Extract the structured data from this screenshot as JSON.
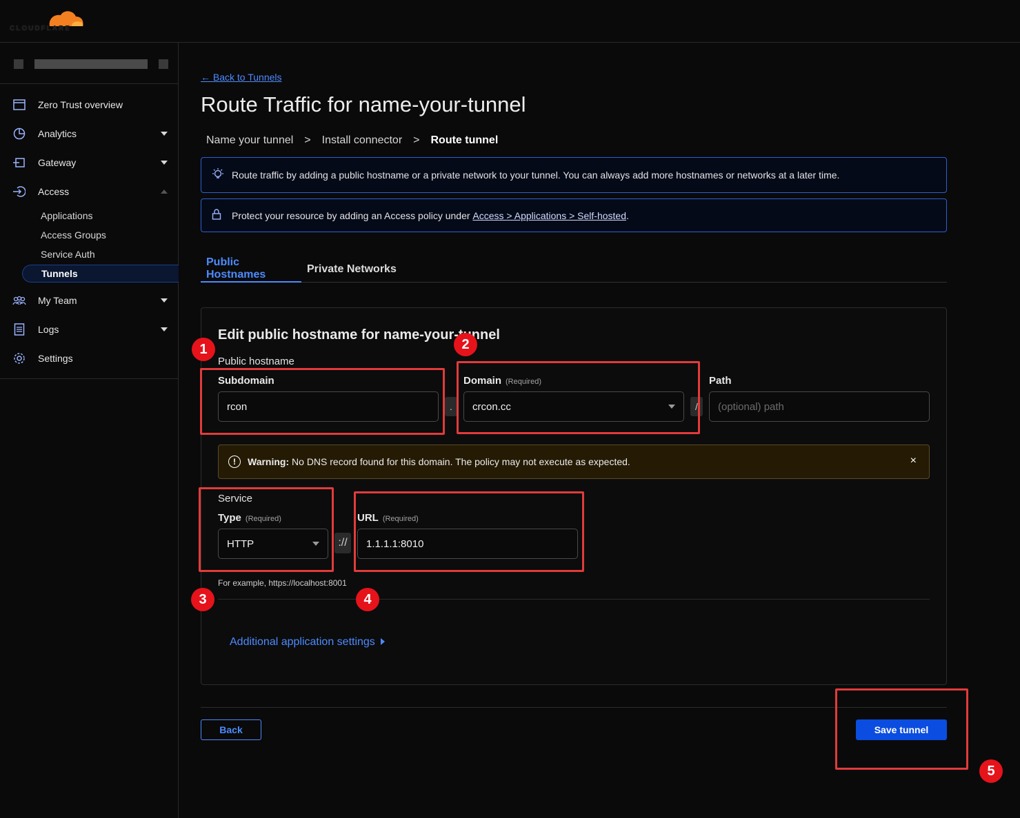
{
  "brand": {
    "logo_text": "CLOUDFLARE",
    "cloud_color": "#f38020"
  },
  "sidebar": {
    "items": [
      {
        "label": "Zero Trust overview",
        "icon": "overview-icon"
      },
      {
        "label": "Analytics",
        "icon": "analytics-icon"
      },
      {
        "label": "Gateway",
        "icon": "gateway-icon"
      },
      {
        "label": "Access",
        "icon": "access-icon"
      },
      {
        "label": "My Team",
        "icon": "team-icon"
      },
      {
        "label": "Logs",
        "icon": "logs-icon"
      },
      {
        "label": "Settings",
        "icon": "settings-icon"
      }
    ],
    "access_sub": [
      "Applications",
      "Access Groups",
      "Service Auth",
      "Tunnels"
    ]
  },
  "main": {
    "back_link": "← Back to Tunnels",
    "title": "Route Traffic for name-your-tunnel",
    "steps": [
      "Name your tunnel",
      ">",
      "Install connector",
      ">",
      "Route tunnel"
    ],
    "banner_info": "Route traffic by adding a public hostname or a private network to your tunnel. You can always add more hostnames or networks at a later time.",
    "banner_protect_prefix": "Protect your resource by adding an Access policy under ",
    "banner_protect_link": "Access > Applications > Self-hosted",
    "banner_protect_suffix": ".",
    "tabs": [
      "Public Hostnames",
      "Private Networks"
    ]
  },
  "form": {
    "title": "Edit public hostname for name-your-tunnel",
    "public_hostname_label": "Public hostname",
    "subdomain_label": "Subdomain",
    "subdomain_value": "rcon",
    "domain_label": "Domain",
    "required": "(Required)",
    "domain_value": "crcon.cc",
    "path_label": "Path",
    "path_placeholder": "(optional) path",
    "dot_sep": ".",
    "slash_sep": "/",
    "warning_bold": "Warning:",
    "warning_text": " No DNS record found for this domain. The policy may not execute as expected.",
    "warning_close": "×",
    "service_label": "Service",
    "type_label": "Type",
    "type_value": "HTTP",
    "scheme_sep": "://",
    "url_label": "URL",
    "url_value": "1.1.1.1:8010",
    "helper": "For example, https://localhost:8001",
    "additional_settings": "Additional application settings"
  },
  "footer": {
    "back": "Back",
    "save": "Save tunnel"
  },
  "annotations": [
    "1",
    "2",
    "3",
    "4",
    "5"
  ],
  "colors": {
    "accent": "#4d8bff",
    "primary_button": "#0b4de0",
    "annotation": "#e23b3b",
    "warning_bg": "#251a04"
  }
}
